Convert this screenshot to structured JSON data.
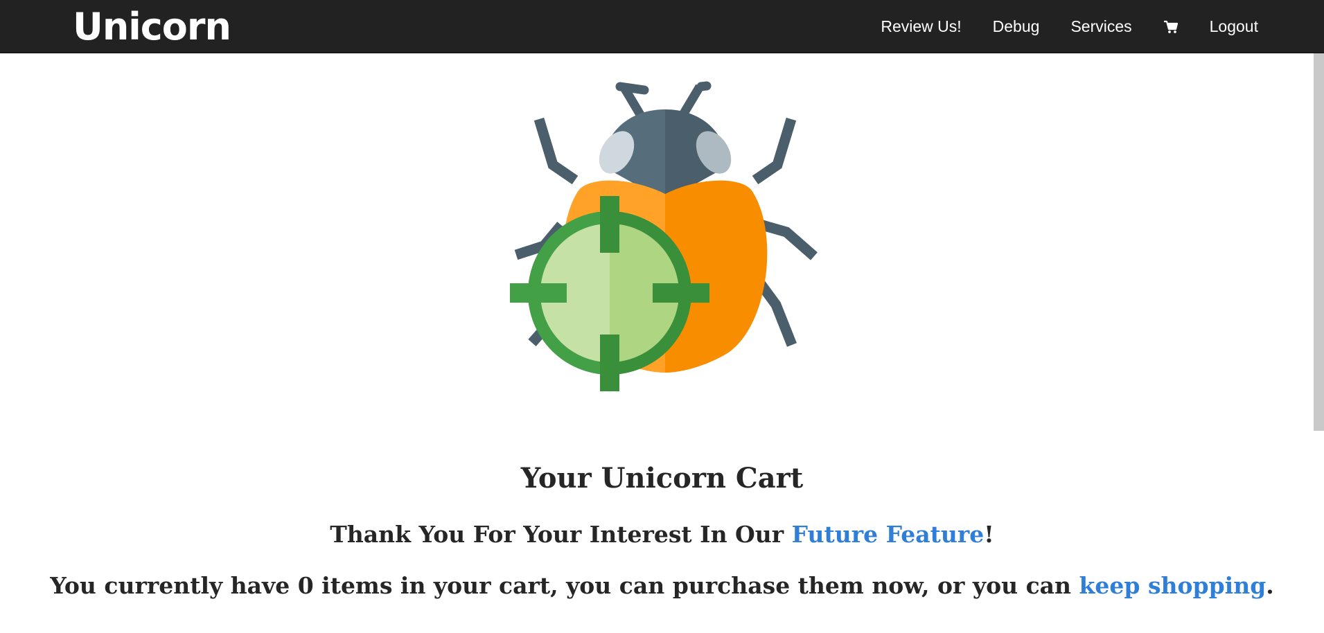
{
  "navbar": {
    "brand": "Unicorn",
    "links": {
      "review": "Review Us!",
      "debug": "Debug",
      "services": "Services",
      "cart_icon": "shopping-cart-icon",
      "logout": "Logout"
    }
  },
  "hero": {
    "image_icon": "bug-with-crosshair-icon"
  },
  "content": {
    "title": "Your Unicorn Cart",
    "thanks_prefix": "Thank You For Your Interest In Our ",
    "thanks_link": "Future Feature",
    "thanks_suffix": "!",
    "info_prefix": "You currently have 0 items in your cart, you can purchase them now, or you can ",
    "info_link": "keep shopping",
    "info_suffix": "."
  },
  "colors": {
    "navbar_bg": "#222222",
    "link": "#2f7fd8",
    "text": "#262626"
  }
}
